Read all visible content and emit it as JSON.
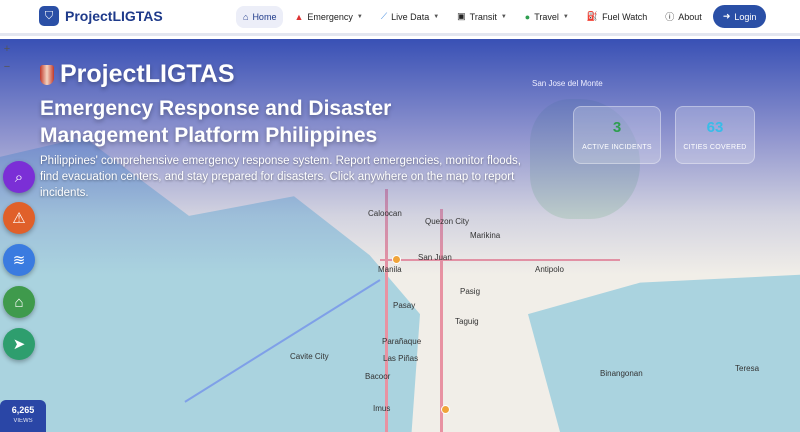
{
  "nav": {
    "brand": "ProjectLIGTAS",
    "items": [
      {
        "label": "Home",
        "icon": "home-icon",
        "active": true
      },
      {
        "label": "Emergency",
        "icon": "warning-icon",
        "dropdown": true
      },
      {
        "label": "Live Data",
        "icon": "chart-icon",
        "dropdown": true
      },
      {
        "label": "Transit",
        "icon": "bus-icon",
        "dropdown": true
      },
      {
        "label": "Travel",
        "icon": "compass-icon",
        "dropdown": true
      },
      {
        "label": "Fuel Watch",
        "icon": "fuel-icon"
      },
      {
        "label": "About",
        "icon": "info-icon"
      }
    ],
    "login": "Login"
  },
  "hero": {
    "title": "ProjectLIGTAS",
    "subtitle": "Emergency Response and Disaster Management Platform Philippines",
    "description": "Philippines' comprehensive emergency response system. Report emergencies, monitor floods, find evacuation centers, and stay prepared for disasters. Click anywhere on the map to report incidents."
  },
  "stats": [
    {
      "value": "3",
      "label": "ACTIVE INCIDENTS",
      "color": "#2e9e4f"
    },
    {
      "value": "63",
      "label": "CITIES COVERED",
      "color": "#38bde8"
    }
  ],
  "map": {
    "places": [
      "Caloocan",
      "Quezon City",
      "Marikina",
      "Manila",
      "San Juan",
      "Pasig",
      "Antipolo",
      "Pasay",
      "Taguig",
      "Cavite City",
      "Parañaque",
      "Las Piñas",
      "Bacoor",
      "Imus",
      "San Jose del Monte",
      "Binangonan",
      "Teresa"
    ]
  },
  "views": {
    "count": "6,265",
    "label": "VIEWS"
  },
  "zoom": {
    "in": "+",
    "out": "−"
  }
}
